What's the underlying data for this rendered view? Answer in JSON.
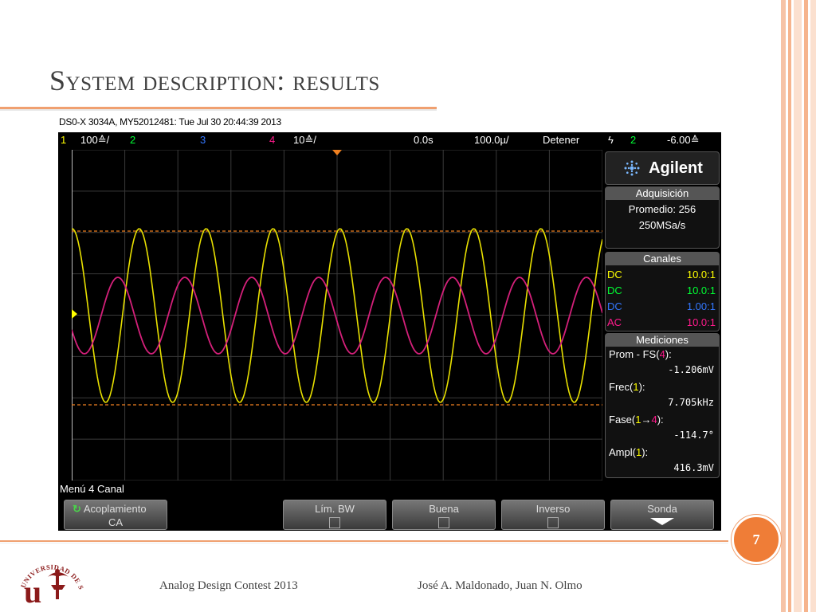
{
  "slide": {
    "title": "System description: results",
    "page_number": "7",
    "footer_left": "Analog Design Contest 2013",
    "footer_right": "José A. Maldonado, Juan N. Olmo",
    "logo_text": "UNIVERSIDAD DE SEVILLA",
    "accent_color": "#ef7d37"
  },
  "scope": {
    "caption": "DS0-X 3034A, MY52012481: Tue Jul 30 20:44:39 2013",
    "topbar": {
      "ch1": "1",
      "ch1_scale": "100≙/",
      "ch2": "2",
      "ch3": "3",
      "ch4": "4",
      "ch4_scale": "10≙/",
      "time_offset": "0.0s",
      "time_scale": "100.0µ/",
      "run_state": "Detener",
      "trigger_icon": "ϟ",
      "trigger_source": "2",
      "trigger_level": "-6.00≙"
    },
    "brand": "Agilent",
    "acquisition": {
      "header": "Adquisición",
      "mode": "Promedio: 256",
      "rate": "250MSa/s"
    },
    "channels": {
      "header": "Canales",
      "rows": [
        {
          "coupling": "DC",
          "probe": "10.0:1",
          "color": "#ffff00"
        },
        {
          "coupling": "DC",
          "probe": "10.0:1",
          "color": "#00ff33"
        },
        {
          "coupling": "DC",
          "probe": "1.00:1",
          "color": "#3377ff"
        },
        {
          "coupling": "AC",
          "probe": "10.0:1",
          "color": "#ff1a8c"
        }
      ]
    },
    "measurements": {
      "header": "Mediciones",
      "items": [
        {
          "label_pre": "Prom - FS(",
          "label_ch": "4",
          "label_post": "):",
          "value": "-1.206mV"
        },
        {
          "label_pre": "Frec(",
          "label_ch": "1",
          "label_post": "):",
          "value": "7.705kHz"
        },
        {
          "label_pre": "Fase(",
          "label_ch": "1→4",
          "label_post": "):",
          "value": "-114.7°"
        },
        {
          "label_pre": "Ampl(",
          "label_ch": "1",
          "label_post": "):",
          "value": "416.3mV"
        }
      ]
    },
    "menu_label": "Menú 4 Canal",
    "softkeys": [
      {
        "label": "Acoplamiento",
        "value": "CA"
      },
      {
        "label": "Lím. BW"
      },
      {
        "label": "Buena"
      },
      {
        "label": "Inverso"
      },
      {
        "label": "Sonda"
      }
    ],
    "traces": {
      "ch1_color": "#e8e000",
      "ch4_color": "#d4207a",
      "cursor_color": "#f08020"
    }
  }
}
